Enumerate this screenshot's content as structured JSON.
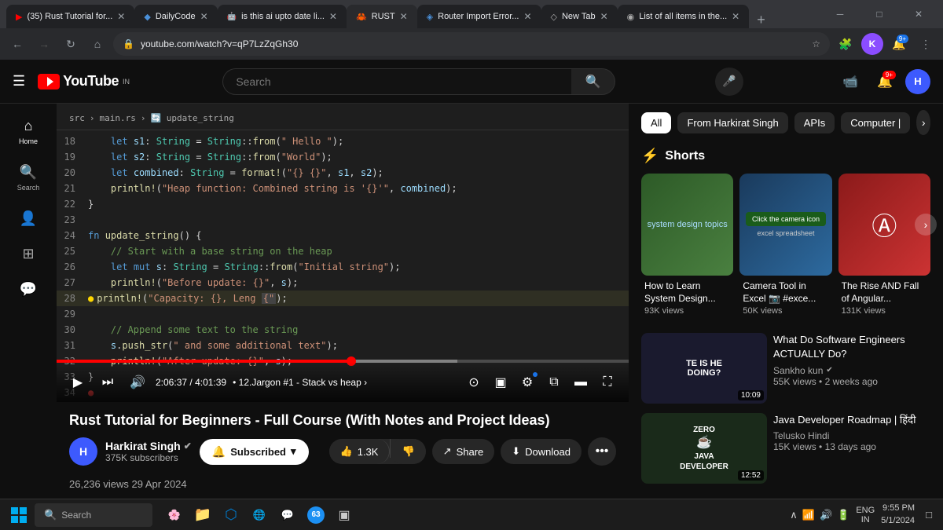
{
  "browser": {
    "tabs": [
      {
        "id": "tab-rust",
        "label": "(35) Rust Tutorial for...",
        "favicon": "▶",
        "active": false,
        "favColor": "#ff0000"
      },
      {
        "id": "tab-dailycode",
        "label": "DailyCode",
        "favicon": "◆",
        "active": false,
        "favColor": "#4a90d9"
      },
      {
        "id": "tab-ai",
        "label": "is this ai upto date li...",
        "favicon": "🤖",
        "active": false,
        "favColor": "#555"
      },
      {
        "id": "tab-rust2",
        "label": "RUST",
        "favicon": "🦀",
        "active": true,
        "favColor": "#ce422b"
      },
      {
        "id": "tab-router",
        "label": "Router Import Error...",
        "favicon": "◈",
        "active": false,
        "favColor": "#4a90d9"
      },
      {
        "id": "tab-newtab",
        "label": "New Tab",
        "favicon": "◇",
        "active": false,
        "favColor": "#aaa"
      },
      {
        "id": "tab-list",
        "label": "List of all items in the...",
        "favicon": "◉",
        "active": false,
        "favColor": "#aaa"
      }
    ],
    "url": "youtube.com/watch?v=qP7LzZqGh30",
    "window_controls": {
      "minimize": "─",
      "maximize": "□",
      "close": "✕"
    }
  },
  "youtube": {
    "header": {
      "search_placeholder": "Search",
      "logo_text": "YouTube",
      "logo_region": "IN",
      "notification_count": "9+"
    },
    "sidebar": {
      "items": [
        {
          "icon": "☰",
          "label": "Home"
        },
        {
          "icon": "🔍",
          "label": ""
        },
        {
          "icon": "👤",
          "label": ""
        },
        {
          "icon": "⊞",
          "label": ""
        },
        {
          "icon": "💬",
          "label": ""
        }
      ]
    },
    "video": {
      "title": "Rust Tutorial for Beginners - Full Course (With Notes and Project Ideas)",
      "views": "26,236 views",
      "date": "29 Apr 2024",
      "progress_time": "2:06:37",
      "total_time": "4:01:39",
      "chapter": "12.Jargon #1 - Stack vs heap",
      "channel": {
        "name": "Harkirat Singh",
        "subscribers": "375K subscribers",
        "verified": true
      },
      "like_count": "1.3K",
      "buttons": {
        "subscribe": "Subscribed",
        "like": "1.3K",
        "share": "Share",
        "download": "Download"
      }
    },
    "code": {
      "breadcrumb": [
        "src",
        "main.rs",
        "update_string"
      ],
      "lines": [
        {
          "num": 18,
          "content": "    let s1: String = String::from( Hello  );",
          "highlight": false
        },
        {
          "num": 19,
          "content": "    let s2: String = String::from(\"World\");",
          "highlight": false
        },
        {
          "num": 20,
          "content": "    let combined: String = format!(\"{} {}\", s1, s2);",
          "highlight": false
        },
        {
          "num": 21,
          "content": "    println!(\"Heap function: Combined string is '{}'\", combined);",
          "highlight": false
        },
        {
          "num": 22,
          "content": "}",
          "highlight": false
        },
        {
          "num": 23,
          "content": "",
          "highlight": false
        },
        {
          "num": 24,
          "content": "fn update_string() {",
          "highlight": false
        },
        {
          "num": 25,
          "content": "    // Start with a base string on the heap",
          "highlight": false
        },
        {
          "num": 26,
          "content": "    let mut s: String = String::from(\"Initial string\");",
          "highlight": false
        },
        {
          "num": 27,
          "content": "    println!(\"Before update: {}\", s);",
          "highlight": false
        },
        {
          "num": 28,
          "content": "    println!(\"Capacity: {}, Leng {}\",",
          "highlight": true,
          "marker": "yellow"
        },
        {
          "num": 29,
          "content": "",
          "highlight": false
        },
        {
          "num": 30,
          "content": "    // Append some text to the string",
          "highlight": false
        },
        {
          "num": 31,
          "content": "    s.push_str(\" and some additional text\");",
          "highlight": false
        },
        {
          "num": 32,
          "content": "    println!(\"After update: {}\", s);",
          "highlight": false
        },
        {
          "num": 33,
          "content": "}",
          "highlight": false
        },
        {
          "num": 34,
          "content": "",
          "highlight": false,
          "marker": "red"
        }
      ]
    },
    "filter_chips": [
      {
        "label": "All",
        "active": true
      },
      {
        "label": "From Harkirat Singh",
        "active": false
      },
      {
        "label": "APIs",
        "active": false
      },
      {
        "label": "Computer |",
        "active": false
      }
    ],
    "shorts": {
      "title": "Shorts",
      "items": [
        {
          "title": "How to Learn System Design...",
          "views": "93K views",
          "color": "green"
        },
        {
          "title": "Camera Tool in Excel 📷 #exce...",
          "views": "50K views",
          "color": "blue"
        },
        {
          "title": "The Rise AND Fall of Angular...",
          "views": "131K views",
          "color": "red"
        }
      ]
    },
    "recommended": [
      {
        "title": "What Do Software Engineers ACTUALLY Do?",
        "channel": "Sankho kun",
        "verified": true,
        "views": "55K views",
        "age": "2 weeks ago",
        "duration": "10:09",
        "thumb_color": "#1a1a2e"
      },
      {
        "title": "Java Developer Roadmap | हिंदी",
        "channel": "Telusko Hindi",
        "verified": false,
        "views": "15K views",
        "age": "13 days ago",
        "duration": "12:52",
        "thumb_color": "#1a2a1a"
      }
    ]
  },
  "taskbar": {
    "search_placeholder": "Search",
    "time": "9:55 PM",
    "date": "5/1/2024",
    "language": "ENG",
    "language_region": "IN"
  }
}
